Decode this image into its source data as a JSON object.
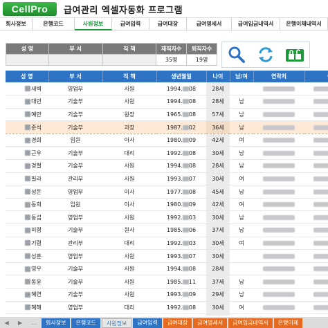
{
  "app": {
    "logo_text": "CellPro",
    "title": "급여관리 엑셀자동화 프로그램"
  },
  "menu": [
    {
      "label": "회사정보",
      "active": false
    },
    {
      "label": "은행코드",
      "active": false
    },
    {
      "label": "사원정보",
      "active": true
    },
    {
      "label": "급여입력",
      "active": false
    },
    {
      "label": "급여대장",
      "active": false
    },
    {
      "label": "급여명세서",
      "active": false
    },
    {
      "label": "급여입금내역서",
      "active": false
    },
    {
      "label": "은행이체내역서",
      "active": false
    }
  ],
  "summary": {
    "headers": [
      "성 명",
      "부 서",
      "직 책",
      "재직자수",
      "퇴직자수"
    ],
    "employed": "35명",
    "retired": "19명"
  },
  "toolbox": {
    "icons": [
      "search-icon",
      "refresh-icon",
      "unlock-icon"
    ]
  },
  "table": {
    "headers": [
      "성 명",
      "부 서",
      "직 책",
      "생년월일",
      "나이",
      "남/여",
      "연락처",
      "이메일"
    ],
    "rows": [
      {
        "name": "새벽",
        "dept": "영업부",
        "pos": "사원",
        "bday_a": "1994.",
        "bday_b": "08",
        "age": "28세",
        "gender": "",
        "sel": false
      },
      {
        "name": "대민",
        "dept": "기술부",
        "pos": "사원",
        "bday_a": "1994.",
        "bday_b": "08",
        "age": "28세",
        "gender": "남",
        "sel": false
      },
      {
        "name": "예만",
        "dept": "기술부",
        "pos": "원장",
        "bday_a": "1965.",
        "bday_b": "08",
        "age": "57세",
        "gender": "남",
        "sel": false
      },
      {
        "name": "준석",
        "dept": "기술부",
        "pos": "과장",
        "bday_a": "1987.",
        "bday_b": "02",
        "age": "36세",
        "gender": "남",
        "sel": true
      },
      {
        "name": "경희",
        "dept": "임원",
        "pos": "이사",
        "bday_a": "1980.",
        "bday_b": "09",
        "age": "42세",
        "gender": "여",
        "sel": false
      },
      {
        "name": "근우",
        "dept": "기술부",
        "pos": "대리",
        "bday_a": "1992.",
        "bday_b": "08",
        "age": "30세",
        "gender": "남",
        "sel": false
      },
      {
        "name": "경철",
        "dept": "기술부",
        "pos": "사원",
        "bday_a": "1994.",
        "bday_b": "08",
        "age": "28세",
        "gender": "남",
        "sel": false
      },
      {
        "name": "필라",
        "dept": "관리부",
        "pos": "사원",
        "bday_a": "1993.",
        "bday_b": "07",
        "age": "30세",
        "gender": "여",
        "sel": false
      },
      {
        "name": "성돈",
        "dept": "영업부",
        "pos": "이사",
        "bday_a": "1977.",
        "bday_b": "08",
        "age": "45세",
        "gender": "남",
        "sel": false
      },
      {
        "name": "동희",
        "dept": "임원",
        "pos": "이사",
        "bday_a": "1980.",
        "bday_b": "09",
        "age": "42세",
        "gender": "여",
        "sel": false
      },
      {
        "name": "동섭",
        "dept": "영업부",
        "pos": "사원",
        "bday_a": "1992.",
        "bday_b": "03",
        "age": "30세",
        "gender": "남",
        "sel": false
      },
      {
        "name": "미령",
        "dept": "기술부",
        "pos": "원사",
        "bday_a": "1985.",
        "bday_b": "06",
        "age": "37세",
        "gender": "남",
        "sel": false
      },
      {
        "name": "기령",
        "dept": "관리부",
        "pos": "대리",
        "bday_a": "1992.",
        "bday_b": "03",
        "age": "30세",
        "gender": "여",
        "sel": false
      },
      {
        "name": "성훈",
        "dept": "영업부",
        "pos": "사원",
        "bday_a": "1993.",
        "bday_b": "07",
        "age": "30세",
        "gender": "",
        "sel": false
      },
      {
        "name": "영우",
        "dept": "기술부",
        "pos": "사원",
        "bday_a": "1994.",
        "bday_b": "08",
        "age": "28세",
        "gender": "",
        "sel": false
      },
      {
        "name": "동윤",
        "dept": "기술부",
        "pos": "사원",
        "bday_a": "1985.",
        "bday_b": "11",
        "age": "37세",
        "gender": "남",
        "sel": false
      },
      {
        "name": "혜연",
        "dept": "기술부",
        "pos": "사원",
        "bday_a": "1993.",
        "bday_b": "09",
        "age": "29세",
        "gender": "남",
        "sel": false
      },
      {
        "name": "혜해",
        "dept": "영업부",
        "pos": "대리",
        "bday_a": "1992.",
        "bday_b": "08",
        "age": "30세",
        "gender": "여",
        "sel": false
      },
      {
        "name": "한별",
        "dept": "기술부",
        "pos": "사원",
        "bday_a": "1994.",
        "bday_b": "08",
        "age": "28세",
        "gender": "",
        "sel": false
      },
      {
        "name": "명훈",
        "dept": "기술부",
        "pos": "대리",
        "bday_a": "1992.",
        "bday_b": "03",
        "age": "30세",
        "gender": "",
        "sel": false
      }
    ]
  },
  "sheet_tabs": [
    {
      "label": "회사정보",
      "style": "blue"
    },
    {
      "label": "은행코드",
      "style": "blue"
    },
    {
      "label": "사원정보",
      "style": "light"
    },
    {
      "label": "급여입력",
      "style": "blue"
    },
    {
      "label": "급여대장",
      "style": "orange"
    },
    {
      "label": "급여명세서",
      "style": "orange"
    },
    {
      "label": "급여입금내역서",
      "style": "orange"
    },
    {
      "label": "은행이체",
      "style": "orange"
    }
  ],
  "sheet_nav": [
    "◀",
    "▶",
    "…"
  ],
  "colors": {
    "brand": "#1f8d2c",
    "header_blue": "#2f73c4",
    "tab_orange": "#e46b1f",
    "selected_row": "#fde9d6"
  }
}
